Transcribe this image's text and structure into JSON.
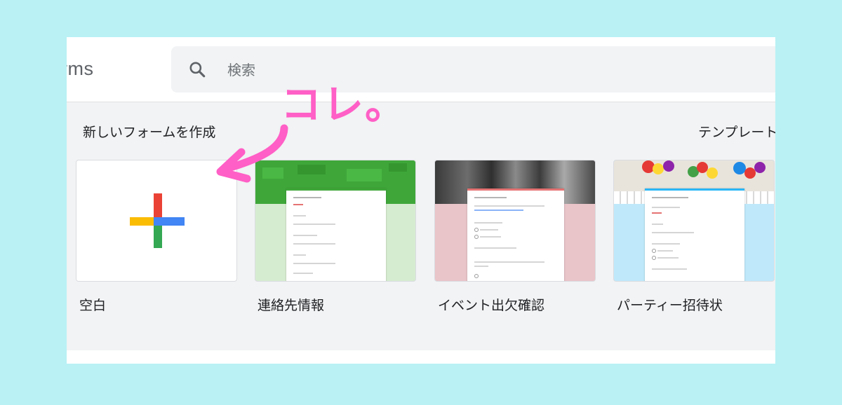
{
  "header": {
    "app_name_partial": "rms",
    "search": {
      "placeholder": "検索"
    }
  },
  "new_form": {
    "title": "新しいフォームを作成",
    "gallery_link": "テンプレート",
    "templates": [
      {
        "label": "空白"
      },
      {
        "label": "連絡先情報"
      },
      {
        "label": "イベント出欠確認"
      },
      {
        "label": "パーティー招待状"
      }
    ]
  },
  "annotation": {
    "text": "コレ。"
  },
  "colors": {
    "background": "#b9f1f5",
    "annotation_pink": "#ff5fc6",
    "plus_red": "#ea4335",
    "plus_blue": "#4285f4",
    "plus_yellow": "#fbbc04",
    "plus_green": "#34a853",
    "contact_green": "#3fa73a",
    "event_pink": "#e9c4c8",
    "party_blue": "#bfe9fb"
  },
  "icons": {
    "search": "search-icon",
    "blank": "google-plus-icon",
    "arrow": "arrow-icon"
  }
}
